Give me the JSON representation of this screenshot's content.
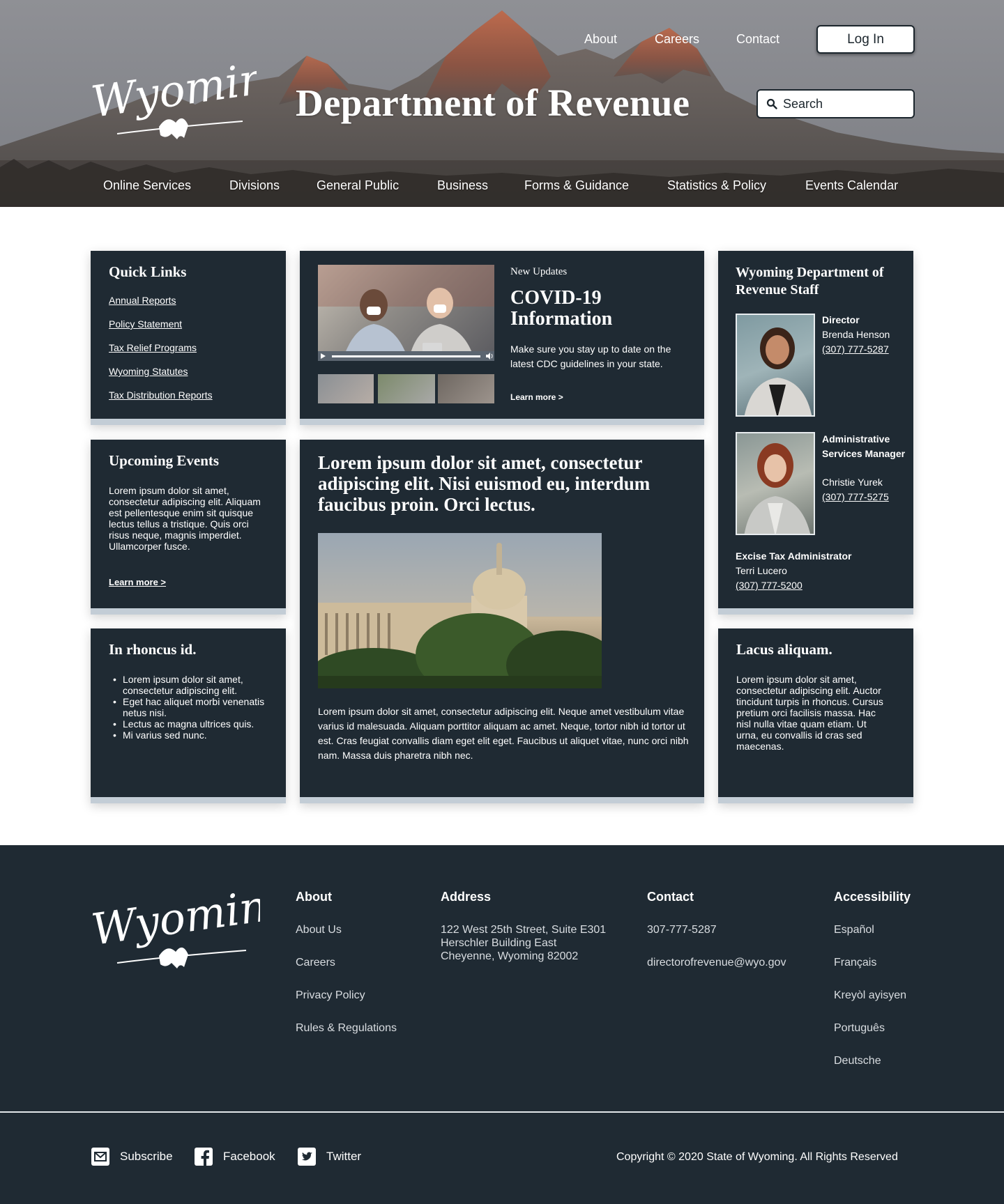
{
  "header": {
    "top_nav": [
      "About",
      "Careers",
      "Contact"
    ],
    "login_label": "Log In",
    "logo_text": "Wyoming",
    "title": "Department of Revenue",
    "search_placeholder": "Search",
    "main_nav": [
      "Online Services",
      "Divisions",
      "General Public",
      "Business",
      "Forms & Guidance",
      "Statistics & Policy",
      "Events Calendar"
    ]
  },
  "quick_links": {
    "title": "Quick Links",
    "links": [
      "Annual Reports",
      "Policy Statement",
      "Tax Relief Programs",
      "Wyoming Statutes",
      "Tax Distribution Reports"
    ]
  },
  "covid": {
    "eyebrow": "New Updates",
    "title_line1": "COVID-19",
    "title_line2": "Information",
    "body": "Make sure you stay up to date on the latest CDC guidelines in your state.",
    "link": "Learn more >"
  },
  "staff": {
    "title": "Wyoming Department of Revenue Staff",
    "members": [
      {
        "role": "Director",
        "name": "Brenda Henson",
        "phone": "(307) 777-5287"
      },
      {
        "role": "Administrative Services Manager",
        "name": "Christie Yurek",
        "phone": "(307) 777-5275"
      },
      {
        "role": "Excise Tax Administrator",
        "name": "Terri Lucero",
        "phone": "(307) 777-5200"
      }
    ]
  },
  "events": {
    "title": "Upcoming Events",
    "body": "Lorem ipsum dolor sit amet, consectetur adipiscing elit. Aliquam est pellentesque enim sit quisque lectus tellus a tristique. Quis orci risus neque, magnis imperdiet. Ullamcorper fusce.",
    "link": "Learn more >"
  },
  "feature": {
    "headline": "Lorem ipsum dolor sit amet, consectetur adipiscing elit. Nisi euismod eu, interdum faucibus proin. Orci lectus.",
    "body": "Lorem ipsum dolor sit amet, consectetur adipiscing elit. Neque amet vestibulum vitae varius id malesuada. Aliquam porttitor aliquam ac amet. Neque, tortor nibh id tortor ut est. Cras feugiat convallis diam eget elit eget. Faucibus ut aliquet vitae, nunc orci nibh nam. Massa duis pharetra nibh nec."
  },
  "rhoncus": {
    "title": "In rhoncus id.",
    "items": [
      "Lorem ipsum dolor sit amet, consectetur adipiscing elit.",
      "Eget hac aliquet morbi venenatis netus nisi.",
      "Lectus ac magna ultrices quis.",
      "Mi varius sed nunc."
    ]
  },
  "lacus": {
    "title": "Lacus aliquam.",
    "body": "Lorem ipsum dolor sit amet, consectetur adipiscing elit. Auctor tincidunt turpis in rhoncus. Cursus pretium orci facilisis massa. Hac nisl nulla vitae quam etiam. Ut urna, eu convallis id cras sed maecenas."
  },
  "footer": {
    "logo_text": "Wyoming",
    "about": {
      "heading": "About",
      "links": [
        "About Us",
        "Careers",
        "Privacy Policy",
        "Rules & Regulations"
      ]
    },
    "address": {
      "heading": "Address",
      "lines": [
        "122 West 25th Street, Suite E301",
        "Herschler Building East",
        "Cheyenne, Wyoming 82002"
      ]
    },
    "contact": {
      "heading": "Contact",
      "phone": "307-777-5287",
      "email": "directorofrevenue@wyo.gov"
    },
    "accessibility": {
      "heading": "Accessibility",
      "links": [
        "Español",
        "Français",
        "Kreyòl ayisyen",
        "Português",
        "Deutsche"
      ]
    },
    "social": [
      "Subscribe",
      "Facebook",
      "Twitter"
    ],
    "copyright": "Copyright © 2020 State of Wyoming.  All Rights Reserved"
  },
  "colors": {
    "navy": "#1f2a33",
    "card_border": "#c3cdd6",
    "white": "#ffffff"
  },
  "icons": [
    "search-icon",
    "mail-icon",
    "facebook-icon",
    "twitter-icon",
    "play-icon",
    "volume-icon"
  ]
}
